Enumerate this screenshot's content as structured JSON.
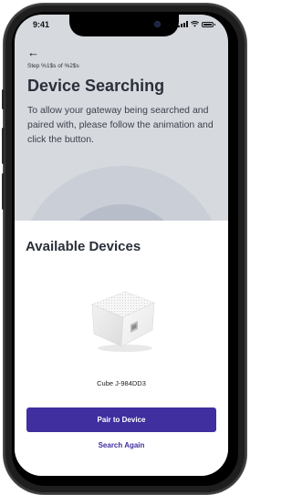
{
  "status_bar": {
    "time": "9:41"
  },
  "header": {
    "back_glyph": "←",
    "step": "Step %1$s of %2$s",
    "title": "Device Searching",
    "description": "To allow your gateway being searched and paired with, please follow the animation and click the button."
  },
  "sheet": {
    "title": "Available Devices",
    "device_name": "Cube J-984DD3",
    "pair_label": "Pair to Device",
    "search_again_label": "Search Again"
  },
  "icons": [
    "back-arrow-icon",
    "signal-icon",
    "wifi-icon",
    "battery-icon",
    "camera-icon"
  ],
  "colors": {
    "accent": "#3f2f9f",
    "background": "#d6d9de",
    "sheet": "#ffffff",
    "title": "#2a2f3a"
  }
}
